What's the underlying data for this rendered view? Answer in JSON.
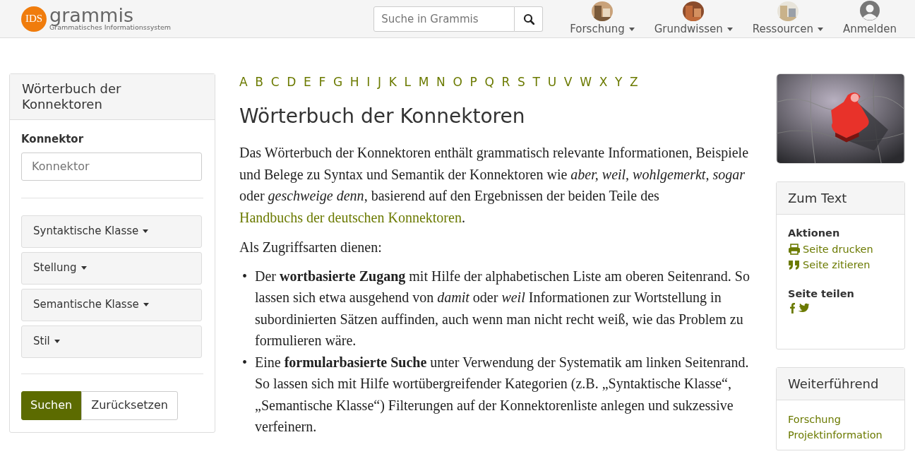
{
  "header": {
    "logo": {
      "badge": "IDS",
      "name": "grammis",
      "subtitle": "Grammatisches Informationssystem"
    },
    "search": {
      "placeholder": "Suche in Grammis"
    },
    "nav": [
      {
        "label": "Forschung",
        "kind": "dropdown"
      },
      {
        "label": "Grundwissen",
        "kind": "dropdown"
      },
      {
        "label": "Ressourcen",
        "kind": "dropdown"
      },
      {
        "label": "Anmelden",
        "kind": "user"
      }
    ]
  },
  "sidebar": {
    "title": "Wörterbuch der Konnektoren",
    "field_label": "Konnektor",
    "placeholder": "Konnektor",
    "filters": [
      "Syntaktische Klasse",
      "Stellung",
      "Semantische Klasse",
      "Stil"
    ],
    "buttons": [
      {
        "label": "Suchen",
        "kind": "primary"
      },
      {
        "label": "Zurücksetzen",
        "kind": "secondary"
      }
    ]
  },
  "main": {
    "alphabet": [
      "A",
      "B",
      "C",
      "D",
      "E",
      "F",
      "G",
      "H",
      "I",
      "J",
      "K",
      "L",
      "M",
      "N",
      "O",
      "P",
      "Q",
      "R",
      "S",
      "T",
      "U",
      "V",
      "W",
      "X",
      "Y",
      "Z"
    ],
    "heading": "Wörterbuch der Konnektoren",
    "intro": {
      "text": "Das Wörterbuch der Konnektoren enthält grammatisch relevante Informationen, Beispiele und Belege zu Syntax und Semantik der Konnektoren wie *aber, weil, wohlgemerkt, sogar* oder *geschweige denn*, basierend auf den Ergebnissen der beiden Teile des",
      "link": "Handbuchs der deutschen Konnektoren",
      "after": "."
    },
    "lead": "Als Zugriffsarten dienen:",
    "bullets": [
      {
        "marker": "•",
        "text": "Der **wortbasierte Zugang** mit Hilfe der alphabetischen Liste am oberen Seitenrand. So lassen sich etwa ausgehend von *damit* oder *weil* Informationen zur Wortstellung in subordinierten Sätzen auffinden, auch wenn man nicht recht weiß, wie das Problem zu formulieren wäre."
      },
      {
        "marker": "•",
        "text": "Eine **formularbasierte Suche** unter Verwendung der Systematik am linken Seitenrand. So lassen sich mit Hilfe wortübergreifender Kategorien (z.B. „Syntaktische Klasse“, „Semantische Klasse“) Filterungen auf der Konnektorenliste anlegen und sukzessive verfeinern."
      }
    ]
  },
  "aside": {
    "zum_text": {
      "title": "Zum Text",
      "sections": [
        {
          "heading": "Aktionen",
          "links": [
            {
              "label": "Seite drucken",
              "kind": "print"
            },
            {
              "label": "Seite zitieren",
              "kind": "cite"
            }
          ]
        },
        {
          "heading": "Seite teilen",
          "share": [
            {
              "kind": "facebook"
            },
            {
              "kind": "twitter"
            }
          ]
        }
      ]
    },
    "weiter": {
      "title": "Weiterführend",
      "links": [
        "Forschung",
        "Projektinformation"
      ]
    }
  }
}
